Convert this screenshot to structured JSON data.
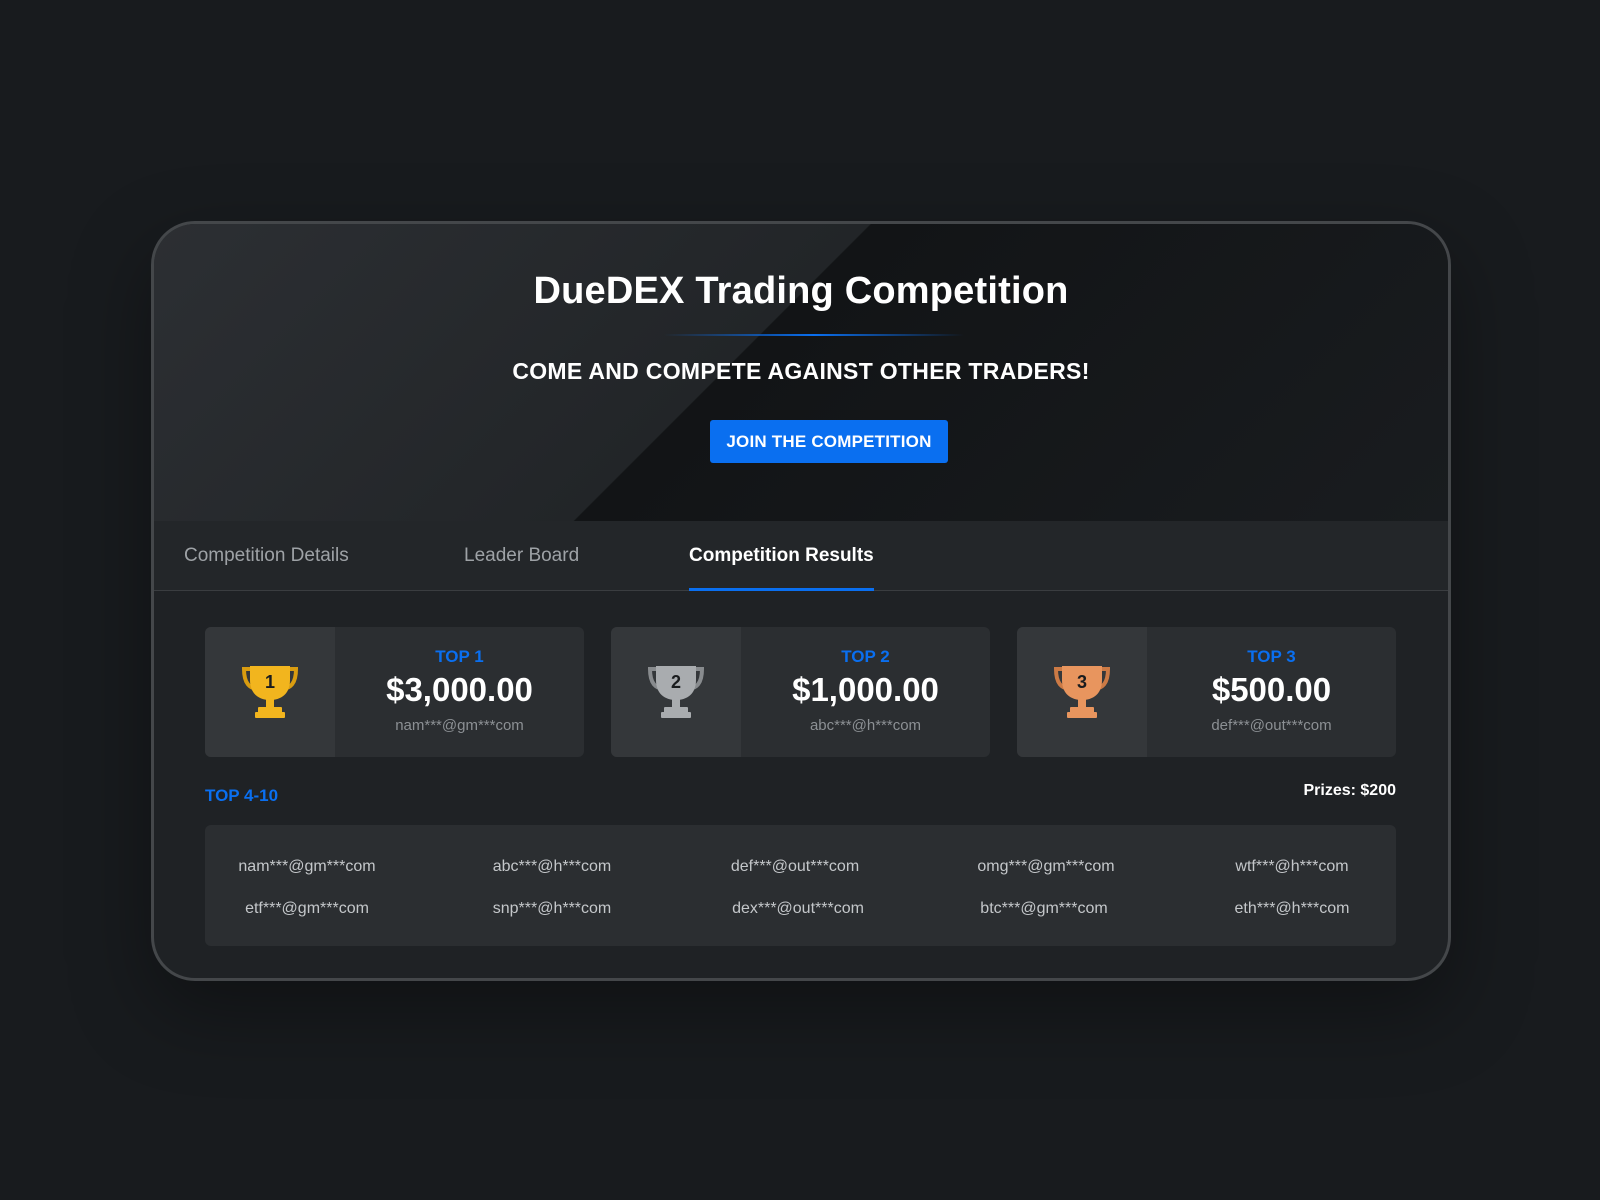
{
  "hero": {
    "title": "DueDEX Trading Competition",
    "subtitle": "COME AND COMPETE AGAINST OTHER TRADERS!",
    "join_label": "JOIN THE COMPETITION"
  },
  "tabs": [
    {
      "label": "Competition Details",
      "active": false
    },
    {
      "label": "Leader Board",
      "active": false
    },
    {
      "label": "Competition Results",
      "active": true
    }
  ],
  "podium": [
    {
      "rank": "TOP 1",
      "place": "1",
      "amount": "$3,000.00",
      "winner": "nam***@gm***com",
      "trophy_color": "#f2b51e",
      "trophy_dark": "#d99c10",
      "icon": "gold-trophy-icon"
    },
    {
      "rank": "TOP 2",
      "place": "2",
      "amount": "$1,000.00",
      "winner": "abc***@h***com",
      "trophy_color": "#a9acaf",
      "trophy_dark": "#888b8e",
      "icon": "silver-trophy-icon"
    },
    {
      "rank": "TOP 3",
      "place": "3",
      "amount": "$500.00",
      "winner": "def***@out***com",
      "trophy_color": "#e8955e",
      "trophy_dark": "#cc7a45",
      "icon": "bronze-trophy-icon"
    }
  ],
  "others": {
    "label": "TOP 4-10",
    "prizes": "Prizes: $200",
    "winners": [
      "nam***@gm***com",
      "abc***@h***com",
      "def***@out***com",
      "omg***@gm***com",
      "wtf***@h***com",
      "etf***@gm***com",
      "snp***@h***com",
      "dex***@out***com",
      "btc***@gm***com",
      "eth***@h***com"
    ]
  },
  "colors": {
    "accent": "#0a6ff0",
    "background": "#181b1e",
    "card": "#1f2225"
  }
}
